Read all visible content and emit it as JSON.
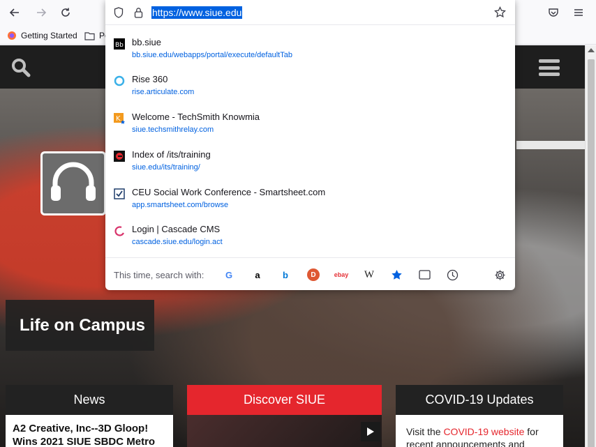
{
  "toolbar": {
    "back": "←",
    "forward": "→",
    "reload": "↻"
  },
  "bookmarks": [
    {
      "label": "Getting Started",
      "icon": "firefox-icon"
    },
    {
      "label": "Po",
      "icon": "folder-icon"
    }
  ],
  "urlbar": {
    "value": "https://www.siue.edu"
  },
  "results": [
    {
      "title": "bb.siue",
      "url": "bb.siue.edu/webapps/portal/execute/defaultTab",
      "icon": "blackboard-icon"
    },
    {
      "title": "Rise 360",
      "url": "rise.articulate.com",
      "icon": "rise-icon"
    },
    {
      "title": "Welcome - TechSmith Knowmia",
      "url": "siue.techsmithrelay.com",
      "icon": "knowmia-icon"
    },
    {
      "title": "Index of /its/training",
      "url": "siue.edu/its/training/",
      "icon": "siue-icon"
    },
    {
      "title": "CEU Social Work Conference - Smartsheet.com",
      "url": "app.smartsheet.com/browse",
      "icon": "smartsheet-icon"
    },
    {
      "title": "Login | Cascade CMS",
      "url": "cascade.siue.edu/login.act",
      "icon": "cascade-icon"
    }
  ],
  "search": {
    "label": "This time, search with:",
    "engines": [
      "G",
      "a",
      "b",
      "D",
      "ebay",
      "W"
    ]
  },
  "site": {
    "campus_label": "Life on Campus",
    "cards": [
      {
        "heading": "News",
        "body": "A2 Creative, Inc--3D Gloop! Wins 2021 SIUE SBDC Metro",
        "color": "#222222"
      },
      {
        "heading": "Discover SIUE",
        "body": "",
        "color": "#e5262d"
      },
      {
        "heading": "COVID-19 Updates",
        "body_prefix": "Visit the ",
        "body_link": "COVID-19 website",
        "body_suffix": " for recent announcements and",
        "color": "#222222"
      }
    ]
  },
  "colors": {
    "accent": "#0061e0",
    "siue_red": "#e5262d",
    "dark": "#222222"
  }
}
